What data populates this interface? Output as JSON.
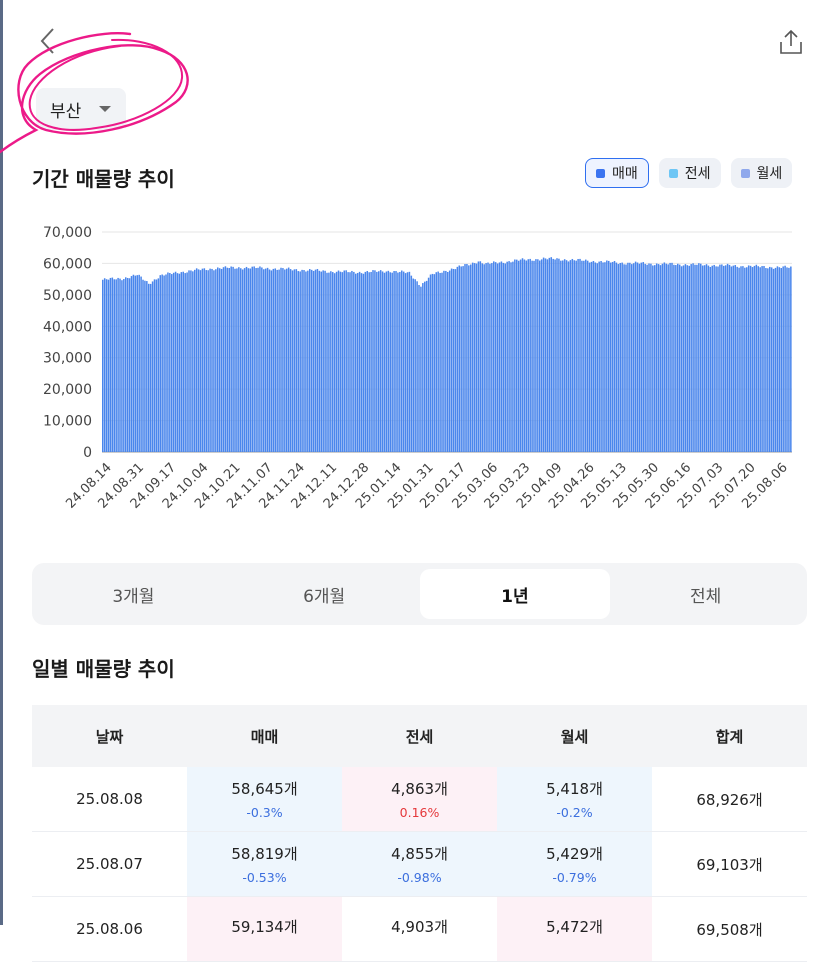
{
  "header": {
    "back_icon": "chevron-left-icon",
    "share_icon": "share-icon"
  },
  "region": {
    "selected": "부산"
  },
  "trend": {
    "title": "기간 매물량 추이",
    "legend": [
      {
        "label": "매매",
        "color": "#3b74f0",
        "active": true
      },
      {
        "label": "전세",
        "color": "#6ec6f5",
        "active": false
      },
      {
        "label": "월세",
        "color": "#8fa8ec",
        "active": false
      }
    ]
  },
  "chart_data": {
    "type": "bar",
    "series": [
      {
        "name": "매매",
        "color": "#4a86ec"
      }
    ],
    "ylim": [
      0,
      70000
    ],
    "yticks": [
      0,
      10000,
      20000,
      30000,
      40000,
      50000,
      60000,
      70000
    ],
    "ytick_labels": [
      "0",
      "10,000",
      "20,000",
      "30,000",
      "40,000",
      "50,000",
      "60,000",
      "70,000"
    ],
    "xtick_labels": [
      "24.08.14",
      "24.08.31",
      "24.09.17",
      "24.10.04",
      "24.10.21",
      "24.11.07",
      "24.11.24",
      "24.12.11",
      "24.12.28",
      "25.01.14",
      "25.01.31",
      "25.02.17",
      "25.03.06",
      "25.03.23",
      "25.04.09",
      "25.04.26",
      "25.05.13",
      "25.05.30",
      "25.06.16",
      "25.07.03",
      "25.07.20",
      "25.08.06"
    ],
    "shape_points": [
      [
        0,
        54800
      ],
      [
        10,
        55200
      ],
      [
        18,
        56300
      ],
      [
        24,
        53600
      ],
      [
        30,
        56100
      ],
      [
        40,
        57200
      ],
      [
        48,
        57800
      ],
      [
        60,
        58500
      ],
      [
        75,
        58700
      ],
      [
        90,
        58300
      ],
      [
        105,
        57900
      ],
      [
        120,
        57400
      ],
      [
        135,
        57200
      ],
      [
        150,
        57600
      ],
      [
        160,
        56900
      ],
      [
        166,
        53000
      ],
      [
        172,
        56500
      ],
      [
        182,
        58200
      ],
      [
        192,
        59800
      ],
      [
        196,
        60800
      ],
      [
        200,
        59800
      ],
      [
        215,
        60900
      ],
      [
        230,
        61500
      ],
      [
        240,
        61300
      ],
      [
        255,
        60700
      ],
      [
        270,
        60200
      ],
      [
        285,
        59900
      ],
      [
        300,
        59700
      ],
      [
        315,
        59500
      ],
      [
        330,
        59200
      ],
      [
        345,
        58900
      ],
      [
        359,
        58645
      ]
    ],
    "grid": true,
    "legend": "top-right"
  },
  "periods": {
    "items": [
      "3개월",
      "6개월",
      "1년",
      "전체"
    ],
    "active_index": 2
  },
  "daily": {
    "title": "일별 매물량 추이",
    "headers": [
      "날짜",
      "매매",
      "전세",
      "월세",
      "합계"
    ],
    "rows": [
      {
        "date": "25.08.08",
        "sale": "58,645개",
        "sale_chg": "-0.3%",
        "jeonse": "4,863개",
        "jeonse_chg": "0.16%",
        "monthly": "5,418개",
        "monthly_chg": "-0.2%",
        "total": "68,926개"
      },
      {
        "date": "25.08.07",
        "sale": "58,819개",
        "sale_chg": "-0.53%",
        "jeonse": "4,855개",
        "jeonse_chg": "-0.98%",
        "monthly": "5,429개",
        "monthly_chg": "-0.79%",
        "total": "69,103개"
      },
      {
        "date": "25.08.06",
        "sale": "59,134개",
        "sale_chg": "",
        "jeonse": "4,903개",
        "jeonse_chg": "",
        "monthly": "5,472개",
        "monthly_chg": "",
        "total": "69,508개"
      }
    ]
  }
}
